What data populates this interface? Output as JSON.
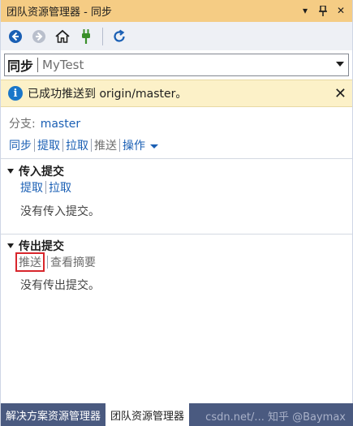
{
  "window": {
    "title": "团队资源管理器 - 同步"
  },
  "toolbar": {
    "icons": [
      "back-arrow-icon",
      "forward-arrow-icon",
      "home-icon",
      "connect-plug-icon",
      "refresh-icon"
    ]
  },
  "page_selector": {
    "main": "同步",
    "sub": "MyTest"
  },
  "info": {
    "message": "已成功推送到 origin/master。"
  },
  "branch": {
    "label": "分支:",
    "value": "master"
  },
  "actions": {
    "sync": "同步",
    "fetch": "提取",
    "pull": "拉取",
    "push": "推送",
    "operations": "操作"
  },
  "incoming": {
    "title": "传入提交",
    "fetch": "提取",
    "pull": "拉取",
    "empty": "没有传入提交。"
  },
  "outgoing": {
    "title": "传出提交",
    "push": "推送",
    "summary": "查看摘要",
    "empty": "没有传出提交。"
  },
  "tabs": {
    "solution_explorer": "解决方案资源管理器",
    "team_explorer": "团队资源管理器"
  },
  "watermark": "csdn.net/...  知乎 @Baymax",
  "colors": {
    "accent": "#1a5fb4",
    "title_bar": "#f5cc84",
    "info_bar": "#fcf1c8",
    "highlight": "#d8262c",
    "tab_bar": "#4a5a80"
  }
}
